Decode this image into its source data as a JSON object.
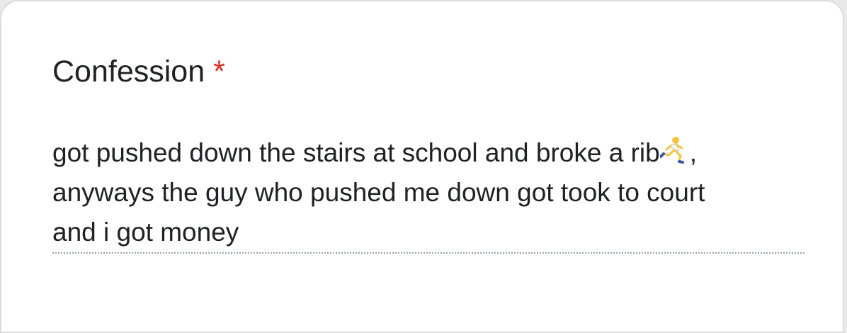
{
  "question": {
    "title": "Confession",
    "required_marker": "*"
  },
  "answer": {
    "line1": "got pushed down the stairs at school and broke a rib",
    "line1_suffix": ",",
    "line2": "anyways the guy who pushed me down got took to court",
    "line3": "and i got money",
    "inline_icon": "person-running-icon"
  },
  "colors": {
    "text": "#202124",
    "required": "#d93025",
    "border": "#dadce0"
  }
}
